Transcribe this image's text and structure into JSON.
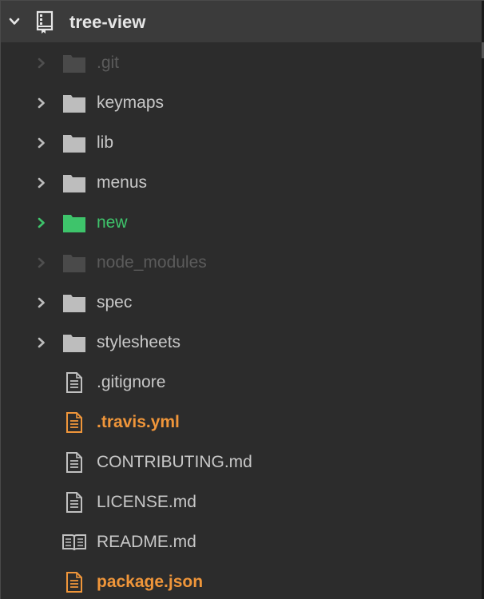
{
  "root": {
    "name": "tree-view",
    "icon": "repo-icon",
    "expanded": true
  },
  "entries": [
    {
      "name": ".git",
      "type": "folder",
      "status": "ignored"
    },
    {
      "name": "keymaps",
      "type": "folder",
      "status": "normal"
    },
    {
      "name": "lib",
      "type": "folder",
      "status": "normal"
    },
    {
      "name": "menus",
      "type": "folder",
      "status": "normal"
    },
    {
      "name": "new",
      "type": "folder",
      "status": "added"
    },
    {
      "name": "node_modules",
      "type": "folder",
      "status": "ignored"
    },
    {
      "name": "spec",
      "type": "folder",
      "status": "normal"
    },
    {
      "name": "stylesheets",
      "type": "folder",
      "status": "normal"
    },
    {
      "name": ".gitignore",
      "type": "file",
      "status": "normal"
    },
    {
      "name": ".travis.yml",
      "type": "file",
      "status": "modified"
    },
    {
      "name": "CONTRIBUTING.md",
      "type": "file",
      "status": "normal"
    },
    {
      "name": "LICENSE.md",
      "type": "file",
      "status": "normal"
    },
    {
      "name": "README.md",
      "type": "readme",
      "status": "normal"
    },
    {
      "name": "package.json",
      "type": "file",
      "status": "modified"
    }
  ],
  "colors": {
    "background": "#2c2c2c",
    "root_header": "#3b3b3b",
    "text": "#c8c8c8",
    "ignored": "#5b5b5b",
    "added": "#3ec46b",
    "modified": "#f0963a"
  }
}
